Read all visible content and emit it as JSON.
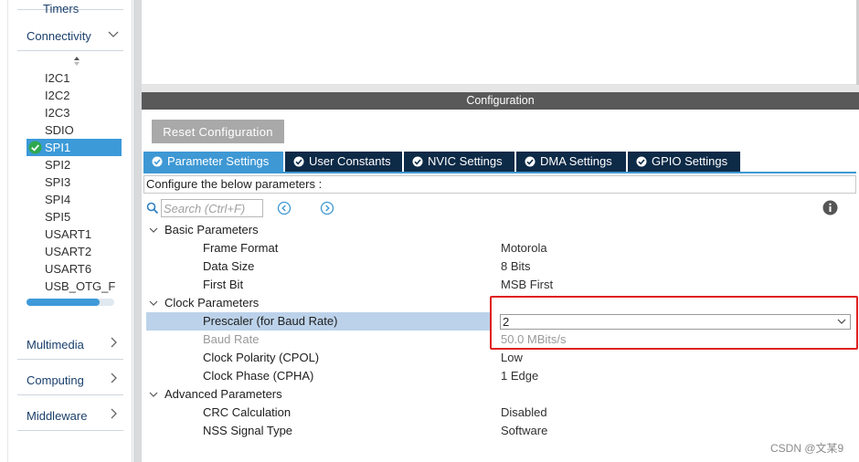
{
  "sidebar": {
    "top_category_label": "Timers",
    "categories": {
      "connectivity": "Connectivity",
      "multimedia": "Multimedia",
      "computing": "Computing",
      "middleware": "Middleware"
    },
    "peripherals": [
      "I2C1",
      "I2C2",
      "I2C3",
      "SDIO",
      "SPI1",
      "SPI2",
      "SPI3",
      "SPI4",
      "SPI5",
      "USART1",
      "USART2",
      "USART6",
      "USB_OTG_F"
    ],
    "selected_peripheral": "SPI1"
  },
  "config": {
    "header": "Configuration",
    "reset_label": "Reset Configuration",
    "tabs": [
      "Parameter Settings",
      "User Constants",
      "NVIC Settings",
      "DMA Settings",
      "GPIO Settings"
    ],
    "active_tab": "Parameter Settings",
    "description": "Configure the below parameters :",
    "search_placeholder": "Search (Ctrl+F)"
  },
  "params": {
    "basic": {
      "label": "Basic Parameters",
      "frame_format": {
        "label": "Frame Format",
        "value": "Motorola"
      },
      "data_size": {
        "label": "Data Size",
        "value": "8 Bits"
      },
      "first_bit": {
        "label": "First Bit",
        "value": "MSB First"
      }
    },
    "clock": {
      "label": "Clock Parameters",
      "prescaler": {
        "label": "Prescaler (for Baud Rate)",
        "value": "2"
      },
      "baud_rate": {
        "label": "Baud Rate",
        "value": "50.0 MBits/s"
      },
      "cpol": {
        "label": "Clock Polarity (CPOL)",
        "value": "Low"
      },
      "cpha": {
        "label": "Clock Phase (CPHA)",
        "value": "1 Edge"
      }
    },
    "advanced": {
      "label": "Advanced Parameters",
      "crc": {
        "label": "CRC Calculation",
        "value": "Disabled"
      },
      "nss": {
        "label": "NSS Signal Type",
        "value": "Software"
      }
    }
  },
  "watermark": "CSDN @文某9",
  "colors": {
    "accent": "#3e98d4",
    "tab_dark": "#0d2a47",
    "header_bg": "#595959",
    "selection": "#bcd2ea",
    "highlight": "#e02020"
  }
}
